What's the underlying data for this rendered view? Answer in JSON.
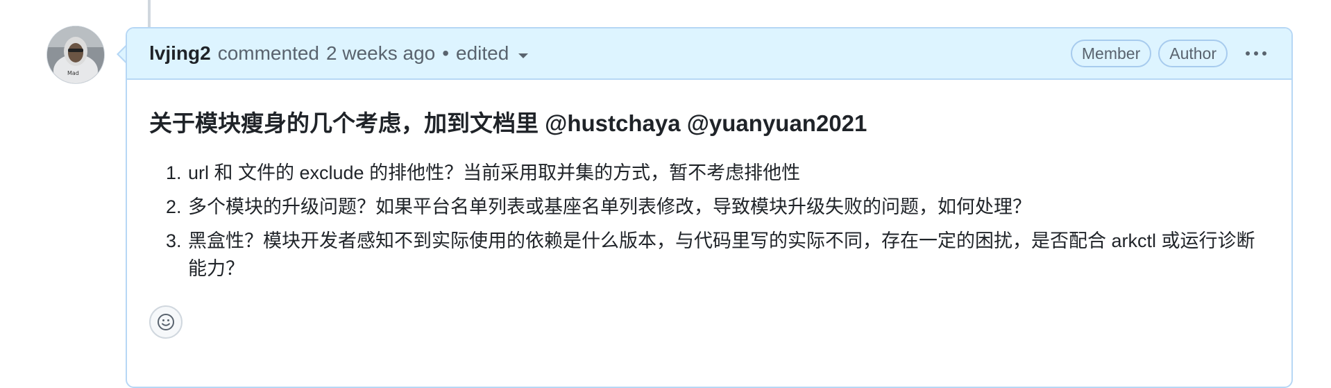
{
  "comment": {
    "author": "lvjing2",
    "action": "commented",
    "time": "2 weeks ago",
    "separator": "•",
    "edited_label": "edited",
    "badges": [
      "Member",
      "Author"
    ],
    "menu_icon": "kebab-horizontal-icon",
    "avatar_icon": "user-avatar",
    "body": {
      "title": "关于模块瘦身的几个考虑，加到文档里 @hustchaya @yuanyuan2021",
      "items": [
        "url 和 文件的 exclude 的排他性？当前采用取并集的方式，暂不考虑排他性",
        "多个模块的升级问题？如果平台名单列表或基座名单列表修改，导致模块升级失败的问题，如何处理？",
        "黑盒性？模块开发者感知不到实际使用的依赖是什么版本，与代码里写的实际不同，存在一定的困扰，是否配合 arkctl 或运行诊断能力？"
      ]
    },
    "reaction_icon": "smiley-icon"
  },
  "colors": {
    "header_bg": "#ddf4ff",
    "border": "#b6d7f5",
    "text": "#1f2328",
    "muted": "#59636e"
  }
}
